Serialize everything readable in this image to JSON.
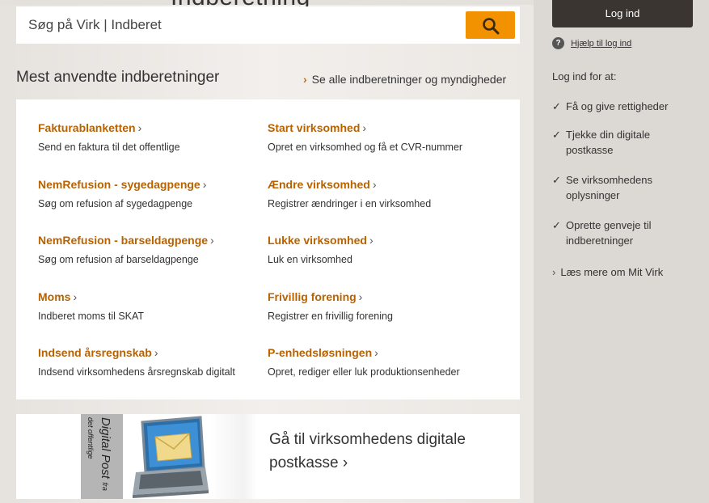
{
  "header": {
    "clipped_heading": "Indberetning",
    "search": {
      "placeholder": "Søg på Virk | Indberet"
    }
  },
  "section": {
    "title": "Mest anvendte indberetninger",
    "see_all": "Se alle indberetninger og myndigheder"
  },
  "links": [
    {
      "title": "Fakturablanketten",
      "desc": "Send en faktura til det offentlige"
    },
    {
      "title": "Start virksomhed",
      "desc": "Opret en virksomhed og få et CVR-nummer"
    },
    {
      "title": "NemRefusion - sygedagpenge",
      "desc": "Søg om refusion af sygedagpenge"
    },
    {
      "title": "Ændre virksomhed",
      "desc": "Registrer ændringer i en virksomhed"
    },
    {
      "title": "NemRefusion - barseldagpenge",
      "desc": "Søg om refusion af barseldagpenge"
    },
    {
      "title": "Lukke virksomhed",
      "desc": "Luk en virksomhed"
    },
    {
      "title": "Moms",
      "desc": "Indberet moms til SKAT"
    },
    {
      "title": "Frivillig forening",
      "desc": "Registrer en frivillig forening"
    },
    {
      "title": "Indsend årsregnskab",
      "desc": "Indsend virksomhedens årsregnskab digitalt"
    },
    {
      "title": "P-enhedsløsningen",
      "desc": "Opret, rediger eller luk produktionsenheder"
    }
  ],
  "banner": {
    "logo_title": "Digital Post",
    "logo_sub": "fra det offentlige",
    "text": "Gå til virksomhedens digitale postkasse",
    "arrow": "›"
  },
  "sidebar": {
    "login": "Log ind",
    "help": "Hjælp til log ind",
    "help_icon": "?",
    "login_for": "Log ind for at:",
    "benefits": [
      "Få og give rettigheder",
      "Tjekke din digitale postkasse",
      "Se virksomhedens oplysninger",
      "Oprette genveje til indberetninger"
    ],
    "read_more": "Læs mere om Mit Virk"
  },
  "icons": {
    "chevron": "›",
    "check": "✓"
  },
  "colors": {
    "accent": "#f39200",
    "link": "#b86200",
    "dark_button": "#3b3532"
  }
}
